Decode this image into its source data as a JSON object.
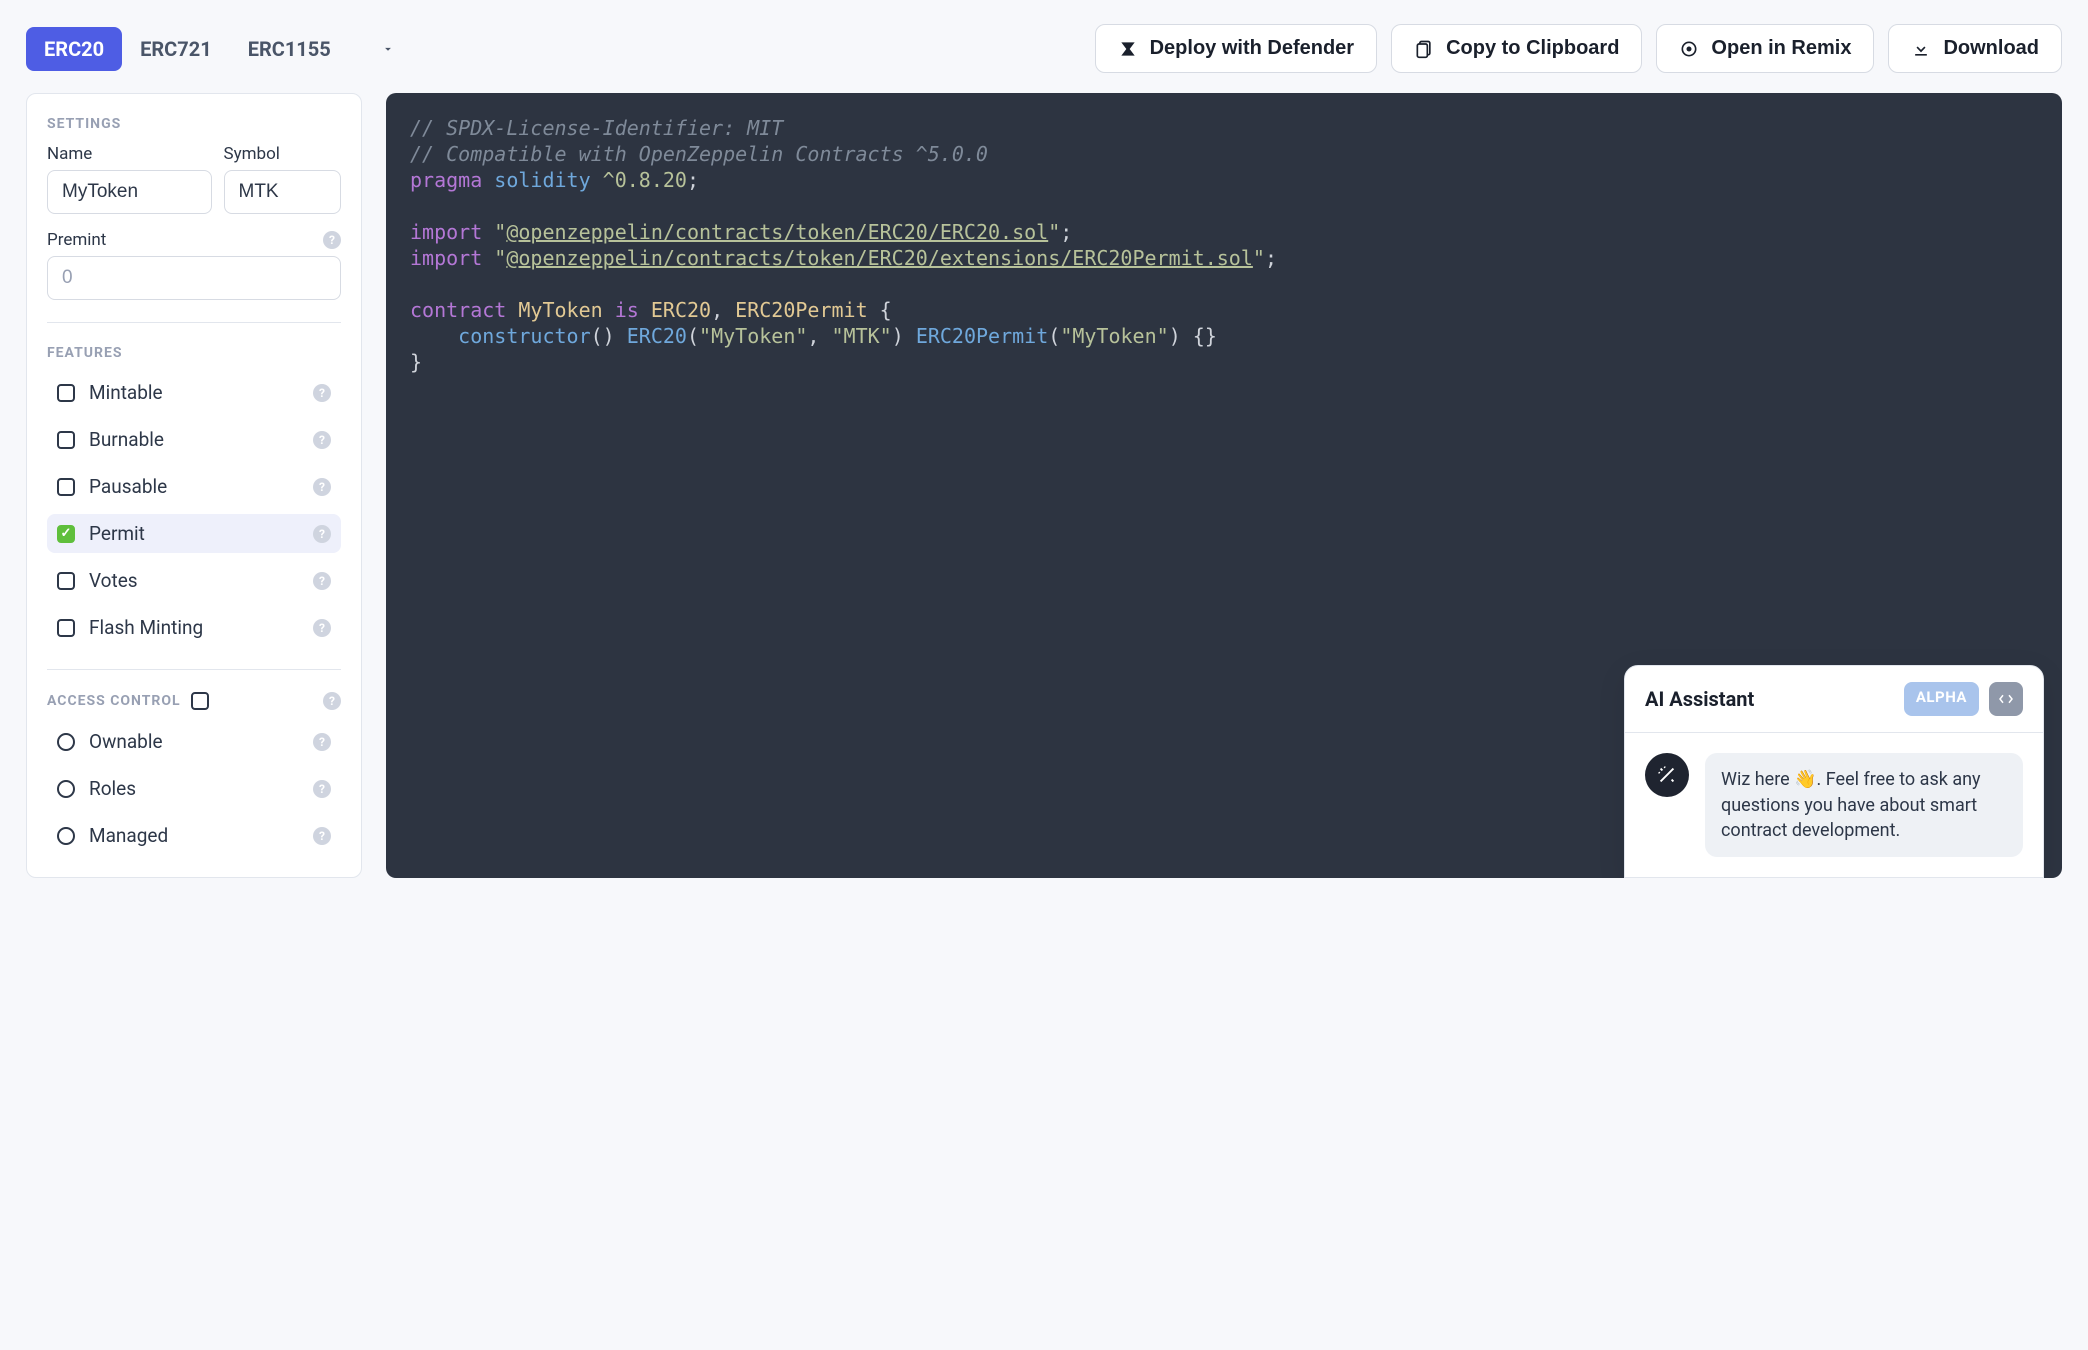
{
  "tabs": [
    {
      "label": "ERC20",
      "active": true
    },
    {
      "label": "ERC721",
      "active": false
    },
    {
      "label": "ERC1155",
      "active": false
    }
  ],
  "actions": {
    "deploy": "Deploy with Defender",
    "copy": "Copy to Clipboard",
    "remix": "Open in Remix",
    "download": "Download"
  },
  "settings": {
    "title": "SETTINGS",
    "name_label": "Name",
    "name_value": "MyToken",
    "symbol_label": "Symbol",
    "symbol_value": "MTK",
    "premint_label": "Premint",
    "premint_placeholder": "0"
  },
  "features": {
    "title": "FEATURES",
    "items": [
      {
        "label": "Mintable",
        "checked": false
      },
      {
        "label": "Burnable",
        "checked": false
      },
      {
        "label": "Pausable",
        "checked": false
      },
      {
        "label": "Permit",
        "checked": true
      },
      {
        "label": "Votes",
        "checked": false
      },
      {
        "label": "Flash Minting",
        "checked": false
      }
    ]
  },
  "access_control": {
    "title": "ACCESS CONTROL",
    "items": [
      {
        "label": "Ownable"
      },
      {
        "label": "Roles"
      },
      {
        "label": "Managed"
      }
    ]
  },
  "code": {
    "c1": "// SPDX-License-Identifier: MIT",
    "c2": "// Compatible with OpenZeppelin Contracts ^5.0.0",
    "pragma_kw": "pragma",
    "pragma_sol": "solidity",
    "pragma_ver": "^0.8.20",
    "import_kw": "import",
    "import1": "@openzeppelin/contracts/token/ERC20/ERC20.sol",
    "import2": "@openzeppelin/contracts/token/ERC20/extensions/ERC20Permit.sol",
    "contract_kw": "contract",
    "contract_name": "MyToken",
    "is_kw": "is",
    "base1": "ERC20",
    "base2": "ERC20Permit",
    "ctor_kw": "constructor",
    "ctor_call1": "ERC20",
    "ctor_arg1a": "\"MyToken\"",
    "ctor_arg1b": "\"MTK\"",
    "ctor_call2": "ERC20Permit",
    "ctor_arg2": "\"MyToken\""
  },
  "assistant": {
    "title": "AI Assistant",
    "badge": "ALPHA",
    "message": "Wiz here 👋. Feel free to ask any questions you have about smart contract development."
  }
}
